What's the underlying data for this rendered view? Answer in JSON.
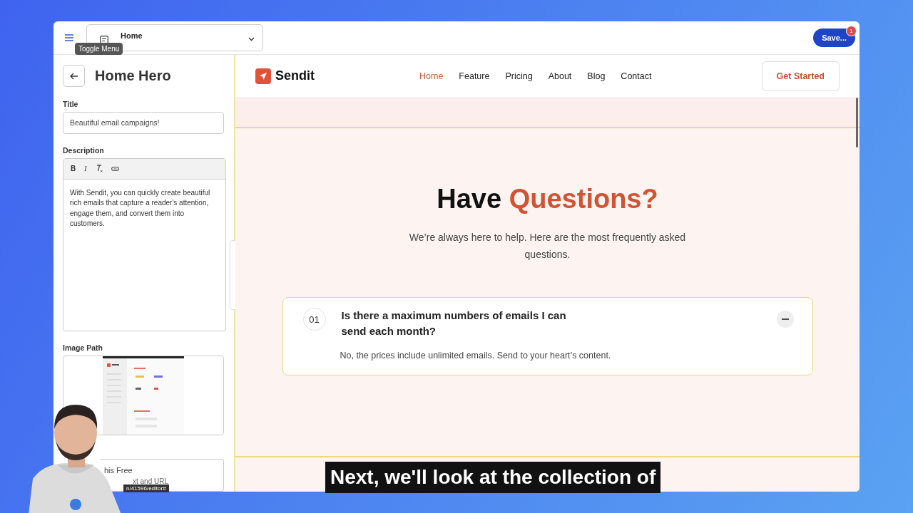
{
  "editor": {
    "menu_tooltip": "Toggle Menu",
    "page_select": "Home",
    "save_button": "Save...",
    "save_badge": "1"
  },
  "panel": {
    "title": "Home Hero",
    "title_field": {
      "label": "Title",
      "value": "Beautiful email campaigns!"
    },
    "description_field": {
      "label": "Description",
      "toolbar": [
        "B",
        "I"
      ],
      "value": "With Sendit, you can quickly create beautiful rich emails that capture a reader's attention, engage them, and convert them into customers."
    },
    "image_field": {
      "label": "Image Path"
    },
    "partial_field": {
      "label": "his Free",
      "value": "xt and URL"
    },
    "status_url": "n/41596/editor#"
  },
  "site": {
    "brand": "Sendit",
    "nav": [
      {
        "label": "Home",
        "selected": true
      },
      {
        "label": "Feature",
        "selected": false
      },
      {
        "label": "Pricing",
        "selected": false
      },
      {
        "label": "About",
        "selected": false
      },
      {
        "label": "Blog",
        "selected": false
      },
      {
        "label": "Contact",
        "selected": false
      }
    ],
    "cta": "Get Started",
    "heading": [
      "Have",
      "Questions?"
    ],
    "subtitle": "We’re always here to help. Here are the most frequently asked questions.",
    "faq": [
      {
        "number": "01",
        "question": "Is there a maximum numbers of emails I can send each month?",
        "answer": "No, the prices include unlimited emails. Send to your heart’s content.",
        "expanded": true
      }
    ]
  },
  "caption": "Next, we'll look at the collection of"
}
